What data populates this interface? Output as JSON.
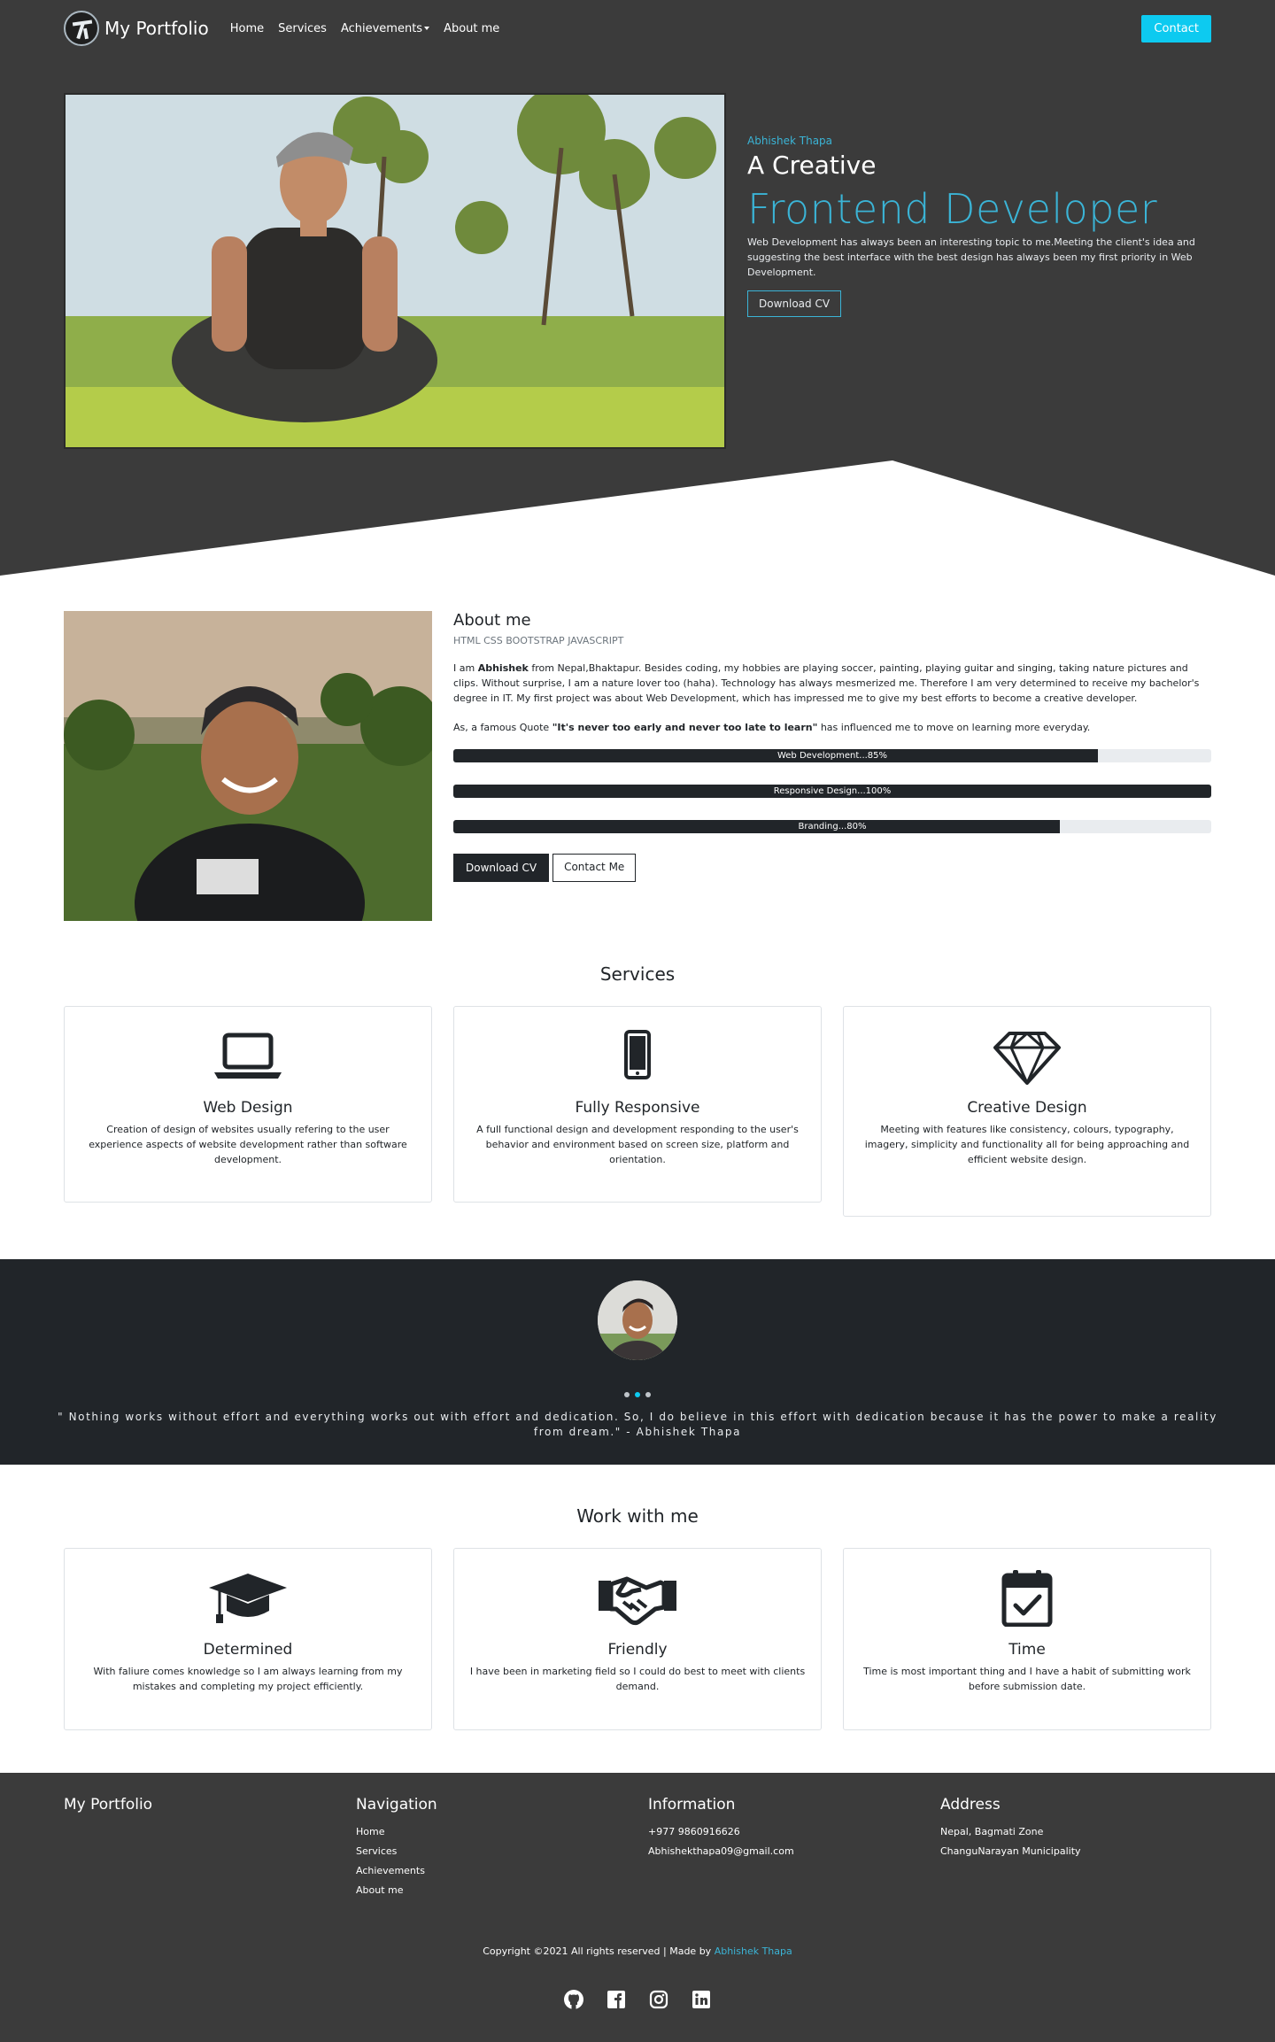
{
  "nav": {
    "brand": "My Portfolio",
    "items": [
      "Home",
      "Services",
      "Achievements",
      "About me"
    ],
    "contact": "Contact"
  },
  "hero": {
    "name": "Abhishek Thapa",
    "creative": "A Creative",
    "role": "Frontend Developer",
    "description": "Web Development has always been an interesting topic to me.Meeting the client's idea and suggesting the best interface with the best design has always been my first priority in Web Development.",
    "download": "Download CV"
  },
  "about": {
    "title": "About me",
    "skills": "HTML CSS BOOTSTRAP JAVASCRIPT",
    "p1_lead": "I am ",
    "p1_name": "Abhishek",
    "p1_rest": " from Nepal,Bhaktapur. Besides coding, my hobbies are playing soccer, painting, playing guitar and singing, taking nature pictures and clips. Without surprise, I am a nature lover too (haha). Technology has always mesmerized me. Therefore I am very determined to receive my bachelor's degree in IT. My first project was about Web Development, which has impressed me to give my best efforts to become a creative developer.",
    "p2_lead": "As, a famous Quote ",
    "p2_quote": "\"It's never too early and never too late to learn\"",
    "p2_rest": " has influenced me to move on learning more everyday.",
    "bars": [
      {
        "label": "Web Development...85%",
        "value": 85
      },
      {
        "label": "Responsive Design...100%",
        "value": 100
      },
      {
        "label": "Branding...80%",
        "value": 80
      }
    ],
    "download": "Download CV",
    "contact": "Contact Me"
  },
  "services": {
    "title": "Services",
    "items": [
      {
        "icon": "laptop-icon",
        "title": "Web Design",
        "text": "Creation of design of websites usually refering to the user experience aspects of website development rather than software development."
      },
      {
        "icon": "phone-icon",
        "title": "Fully Responsive",
        "text": "A full functional design and development responding to the user's behavior and environment based on screen size, platform and orientation."
      },
      {
        "icon": "diamond-icon",
        "title": "Creative Design",
        "text": "Meeting with features like consistency, colours, typography, imagery, simplicity and functionality all for being approaching and efficient website design."
      }
    ]
  },
  "quote": {
    "text": "\" Nothing works without effort and everything works out with effort and dedication. So, I do believe in this effort with dedication because it has the power to make a reality from dream.\" - Abhishek Thapa"
  },
  "work": {
    "title": "Work with me",
    "items": [
      {
        "icon": "graduation-cap-icon",
        "title": "Determined",
        "text": "With faliure comes knowledge so I am always learning from my mistakes and completing my project efficiently."
      },
      {
        "icon": "handshake-icon",
        "title": "Friendly",
        "text": "I have been in marketing field so I could do best to meet with clients demand."
      },
      {
        "icon": "calendar-check-icon",
        "title": "Time",
        "text": "Time is most important thing and I have a habit of submitting work before submission date."
      }
    ]
  },
  "footer": {
    "brand": "My Portfolio",
    "nav_title": "Navigation",
    "nav_items": [
      "Home",
      "Services",
      "Achievements",
      "About me"
    ],
    "info_title": "Information",
    "phone": "+977 9860916626",
    "email": "Abhishekthapa09@gmail.com",
    "address_title": "Address",
    "address1": "Nepal, Bagmati Zone",
    "address2": "ChanguNarayan Municipality",
    "copyright": "Copyright ©2021 All rights reserved | Made by ",
    "author": "Abhishek Thapa"
  },
  "colors": {
    "accent": "#3bb4d6",
    "contact_button": "#0dcaf0",
    "dark_bg": "#3b3b3b",
    "quote_bg": "#212529"
  }
}
